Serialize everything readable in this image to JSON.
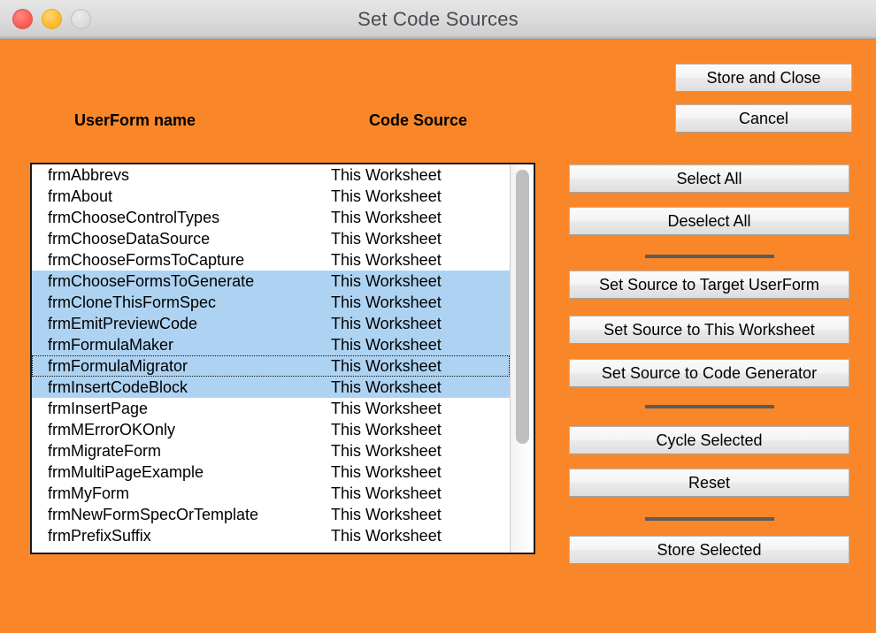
{
  "window": {
    "title": "Set Code Sources",
    "background_color": "#f98729",
    "traffic_lights": [
      {
        "name": "close-button",
        "color": "#fc5f58"
      },
      {
        "name": "minimize-button",
        "color": "#ffbd2e"
      },
      {
        "name": "zoom-button",
        "color": "#dcdcdc"
      }
    ]
  },
  "headers": {
    "name_column": "UserForm name",
    "source_column": "Code Source"
  },
  "list": {
    "rows": [
      {
        "name": "frmAbbrevs",
        "source": "This Worksheet",
        "selected": false,
        "focused": false
      },
      {
        "name": "frmAbout",
        "source": "This Worksheet",
        "selected": false,
        "focused": false
      },
      {
        "name": "frmChooseControlTypes",
        "source": "This Worksheet",
        "selected": false,
        "focused": false
      },
      {
        "name": "frmChooseDataSource",
        "source": "This Worksheet",
        "selected": false,
        "focused": false
      },
      {
        "name": "frmChooseFormsToCapture",
        "source": "This Worksheet",
        "selected": false,
        "focused": false
      },
      {
        "name": "frmChooseFormsToGenerate",
        "source": "This Worksheet",
        "selected": true,
        "focused": false
      },
      {
        "name": "frmCloneThisFormSpec",
        "source": "This Worksheet",
        "selected": true,
        "focused": false
      },
      {
        "name": "frmEmitPreviewCode",
        "source": "This Worksheet",
        "selected": true,
        "focused": false
      },
      {
        "name": "frmFormulaMaker",
        "source": "This Worksheet",
        "selected": true,
        "focused": false
      },
      {
        "name": "frmFormulaMigrator",
        "source": "This Worksheet",
        "selected": true,
        "focused": true
      },
      {
        "name": "frmInsertCodeBlock",
        "source": "This Worksheet",
        "selected": true,
        "focused": false
      },
      {
        "name": "frmInsertPage",
        "source": "This Worksheet",
        "selected": false,
        "focused": false
      },
      {
        "name": "frmMErrorOKOnly",
        "source": "This Worksheet",
        "selected": false,
        "focused": false
      },
      {
        "name": "frmMigrateForm",
        "source": "This Worksheet",
        "selected": false,
        "focused": false
      },
      {
        "name": "frmMultiPageExample",
        "source": "This Worksheet",
        "selected": false,
        "focused": false
      },
      {
        "name": "frmMyForm",
        "source": "This Worksheet",
        "selected": false,
        "focused": false
      },
      {
        "name": "frmNewFormSpecOrTemplate",
        "source": "This Worksheet",
        "selected": false,
        "focused": false
      },
      {
        "name": "frmPrefixSuffix",
        "source": "This Worksheet",
        "selected": false,
        "focused": false
      }
    ],
    "selection_color": "#aed3f2"
  },
  "buttons": {
    "store_and_close": "Store and Close",
    "cancel": "Cancel",
    "select_all": "Select All",
    "deselect_all": "Deselect All",
    "set_source_target_userform": "Set Source to Target UserForm",
    "set_source_this_worksheet": "Set Source to This Worksheet",
    "set_source_code_generator": "Set Source to Code Generator",
    "cycle_selected": "Cycle Selected",
    "reset": "Reset",
    "store_selected": "Store Selected"
  }
}
